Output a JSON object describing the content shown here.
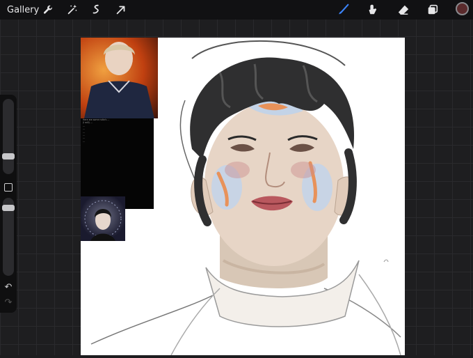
{
  "app": {
    "gallery_label": "Gallery"
  },
  "toolbar": {
    "left_tools": [
      "wrench-icon",
      "magic-wand-icon",
      "selection-icon",
      "transform-arrow-icon"
    ],
    "right_tools": [
      "brush-icon",
      "smudge-icon",
      "eraser-icon",
      "layers-icon"
    ],
    "active_tool": "brush-icon",
    "accent_color": "#3b82f6",
    "current_color": "#5a2a2c"
  },
  "sidebar": {
    "brush_size_level": 0.3,
    "opacity_level": 0.55,
    "undo_icon": "undo-icon",
    "redo_icon": "redo-icon"
  },
  "reference": {
    "text_lines": [
      "Here are some nsfw's ...",
      "(I will) ...",
      "",
      "...",
      "",
      "...",
      "",
      "...",
      "",
      "...",
      "",
      "...",
      "..."
    ]
  }
}
